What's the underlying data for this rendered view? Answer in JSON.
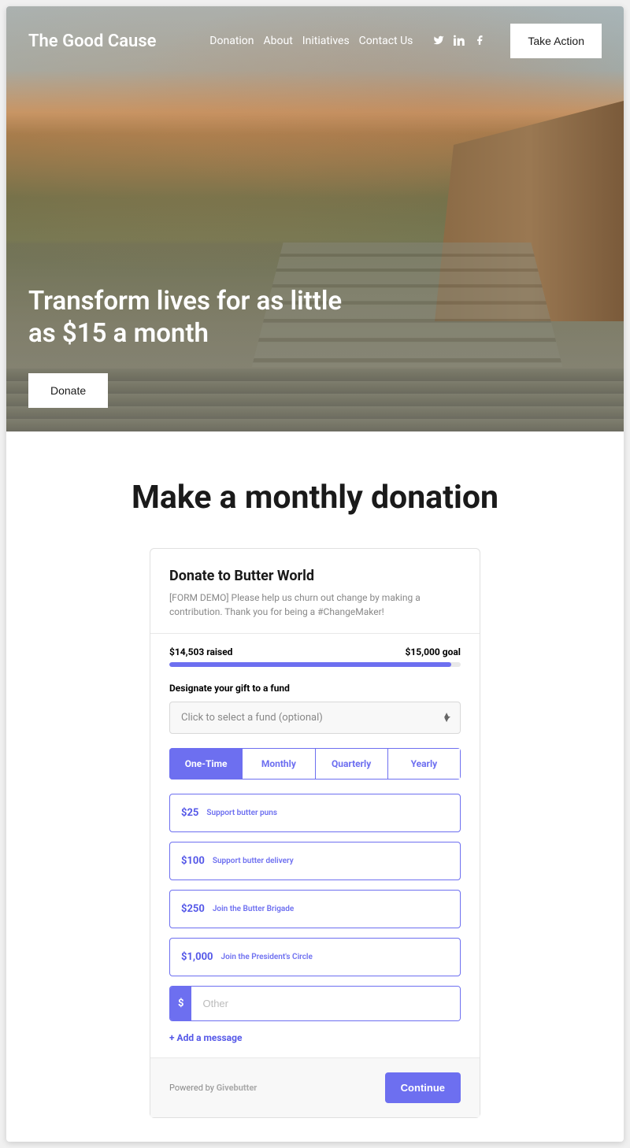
{
  "nav": {
    "logo": "The Good Cause",
    "links": [
      "Donation",
      "About",
      "Initiatives",
      "Contact Us"
    ],
    "cta": "Take Action"
  },
  "hero": {
    "title": "Transform lives for as little as $15 a month",
    "button": "Donate"
  },
  "section": {
    "title": "Make a monthly donation"
  },
  "card": {
    "title": "Donate to Butter World",
    "description": "[FORM DEMO] Please help us churn out change by making a contribution. Thank you for being a #ChangeMaker!",
    "raised_label": "$14,503 raised",
    "goal_label": "$15,000 goal",
    "progress_percent": 96.7,
    "fund_label": "Designate your gift to a fund",
    "fund_placeholder": "Click to select a fund (optional)",
    "frequencies": [
      "One-Time",
      "Monthly",
      "Quarterly",
      "Yearly"
    ],
    "active_frequency": 0,
    "amounts": [
      {
        "value": "$25",
        "label": "Support butter puns"
      },
      {
        "value": "$100",
        "label": "Support butter delivery"
      },
      {
        "value": "$250",
        "label": "Join the Butter Brigade"
      },
      {
        "value": "$1,000",
        "label": "Join the President's Circle"
      }
    ],
    "other_prefix": "$",
    "other_placeholder": "Other",
    "add_message": "+ Add a message",
    "powered_prefix": "Powered by ",
    "powered_brand": "Givebutter",
    "continue": "Continue"
  }
}
